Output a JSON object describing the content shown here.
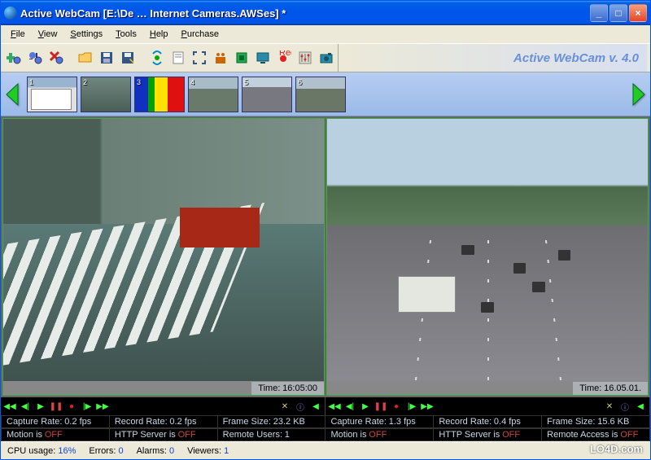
{
  "window": {
    "title": "Active WebCam [E:\\De … Internet Cameras.AWSes] *"
  },
  "menu": {
    "file": "File",
    "view": "View",
    "settings": "Settings",
    "tools": "Tools",
    "help": "Help",
    "purchase": "Purchase"
  },
  "brand": "Active WebCam v. 4.0",
  "toolbar": {
    "icons": [
      "add-camera",
      "configure-camera",
      "delete-camera",
      "open",
      "save",
      "save-as",
      "broadcast",
      "page",
      "fullscreen",
      "people",
      "device",
      "tv-display",
      "record",
      "settings-panel",
      "snapshot"
    ]
  },
  "thumbs": [
    {
      "n": "1"
    },
    {
      "n": "2"
    },
    {
      "n": "3"
    },
    {
      "n": "4"
    },
    {
      "n": "5"
    },
    {
      "n": "6"
    }
  ],
  "cams": {
    "left": {
      "time_label": "Time:",
      "time": "16:05:00"
    },
    "right": {
      "time_label": "Time:",
      "time": "16.05.01."
    }
  },
  "stats": {
    "left": {
      "capture_rate_label": "Capture Rate:",
      "capture_rate": "0.2 fps",
      "record_rate_label": "Record Rate:",
      "record_rate": "0.2 fps",
      "frame_size_label": "Frame Size:",
      "frame_size": "23.2 KB",
      "motion_label": "Motion is",
      "motion": "OFF",
      "http_label": "HTTP Server is",
      "http": "OFF",
      "remote_label": "Remote Users:",
      "remote": "1"
    },
    "right": {
      "capture_rate_label": "Capture Rate:",
      "capture_rate": "1.3 fps",
      "record_rate_label": "Record Rate:",
      "record_rate": "0.4 fps",
      "frame_size_label": "Frame Size:",
      "frame_size": "15.6 KB",
      "motion_label": "Motion is",
      "motion": "OFF",
      "http_label": "HTTP Server is",
      "http": "OFF",
      "remote_label": "Remote Access is",
      "remote": "OFF"
    }
  },
  "status": {
    "cpu_label": "CPU usage:",
    "cpu": "16%",
    "errors_label": "Errors:",
    "errors": "0",
    "alarms_label": "Alarms:",
    "alarms": "0",
    "viewers_label": "Viewers:",
    "viewers": "1"
  },
  "watermark": "LO4D.com"
}
